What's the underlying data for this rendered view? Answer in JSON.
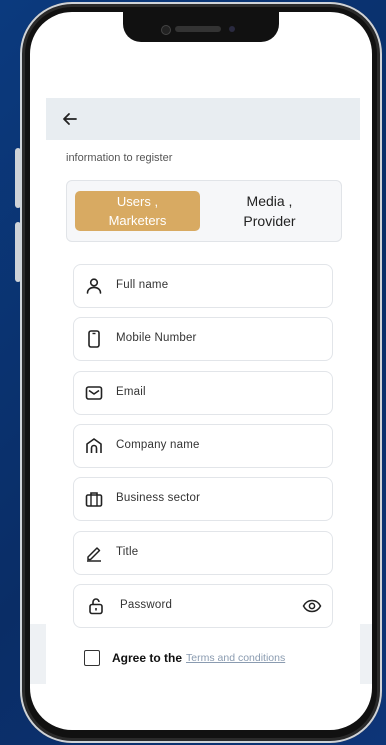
{
  "header": {
    "back_icon": "arrow-left-icon"
  },
  "intro_text": "information to register",
  "segment": {
    "active_label": "Users ,\nMarketers",
    "inactive_label": "Media ,\nProvider",
    "active_color": "#d8aa62"
  },
  "fields": [
    {
      "label": "Full name",
      "icon": "person-icon"
    },
    {
      "label": "Mobile Number",
      "icon": "phone-icon"
    },
    {
      "label": "Email",
      "icon": "mail-icon"
    },
    {
      "label": "Company name",
      "icon": "building-icon"
    },
    {
      "label": "Business sector",
      "icon": "briefcase-icon"
    },
    {
      "label": "Title",
      "icon": "pen-icon"
    },
    {
      "label": "Password",
      "icon": "lock-icon",
      "trailing_icon": "eye-icon"
    }
  ],
  "agree": {
    "prefix": "Agree to the",
    "link": "Terms and conditions"
  }
}
